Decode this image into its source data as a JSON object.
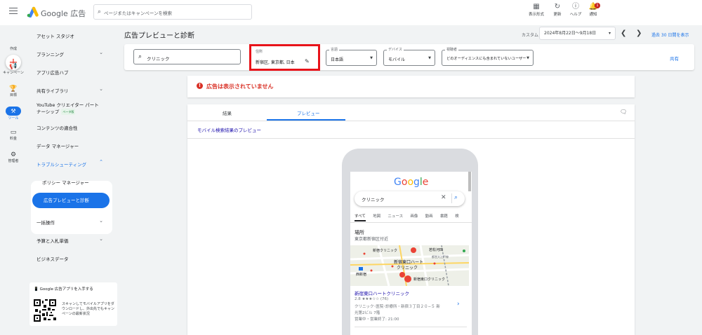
{
  "topbar": {
    "brand": "Google 広告",
    "search_placeholder": "ページまたはキャンペーンを検索",
    "buttons": [
      {
        "label": "表示形式",
        "icon": "view-icon"
      },
      {
        "label": "更新",
        "icon": "refresh-icon"
      },
      {
        "label": "ヘルプ",
        "icon": "help-icon"
      },
      {
        "label": "通知",
        "icon": "bell-icon",
        "badge": "1"
      }
    ]
  },
  "rail": {
    "items": [
      "作成",
      "キャンペーン",
      "目標",
      "ツール",
      "料金",
      "管理者"
    ]
  },
  "sidebar": {
    "items": [
      "アセット スタジオ",
      "プランニング",
      "アプリ広告ハブ",
      "共有ライブラリ",
      "YouTube クリエイター パートナーシップ",
      "コンテンツの適合性",
      "データ マネージャー",
      "トラブルシューティング",
      "ポリシー マネージャー",
      "広告プレビューと診断",
      "一括操作",
      "予算と入札単価",
      "ビジネスデータ"
    ],
    "beta_label": "ベータ版",
    "qr_title": "Google 広告アプリを入手する",
    "qr_text": "スキャンしてモバイルアプリをダウンロードし、外出先でもキャンペーンの最新状況"
  },
  "header": {
    "title": "広告プレビューと診断",
    "date_label": "カスタム",
    "date_range": "2024年8月22日～9月18日",
    "compare_link": "過去 30 日間を表示"
  },
  "filters": {
    "keyword": "クリニック",
    "location_label": "住所",
    "location_value": "新宿区, 東京都, 日本",
    "language_label": "言語",
    "language_value": "日本語",
    "device_label": "デバイス",
    "device_value": "モバイル",
    "audience_label": "視聴者",
    "audience_value": "どのオーディエンスにも含まれていないユーザー",
    "share": "共有"
  },
  "alert": {
    "message": "広告は表示されていません"
  },
  "preview": {
    "tabs": [
      "結果",
      "プレビュー"
    ],
    "mobile_label": "モバイル検索結果のプレビュー",
    "phone": {
      "google": "Google",
      "query": "クリニック",
      "tabs": [
        "すべて",
        "地図",
        "ニュース",
        "画像",
        "動画",
        "書籍",
        "検"
      ],
      "places_title": "場所",
      "places_sub": "東京都新宿区付近",
      "map_labels": [
        "新宿クリニック",
        "若松河田",
        "新宿東口ハート",
        "クリニック",
        "西新宿",
        "新宿東口クリニック",
        "都営大江戸線"
      ],
      "result_title": "新宿東口ハートクリニック",
      "result_rating": "2.8 ★★★☆☆ (76)",
      "result_line1": "クリニック･医院･診療所・新宿３丁目２０−５ 新",
      "result_line2": "光第2ビル 7階",
      "result_line3": "営業中・営業終了: 21:00"
    }
  },
  "colors": {
    "accent": "#1a73e8",
    "alert": "#d93025",
    "highlight": "#e8131a"
  }
}
